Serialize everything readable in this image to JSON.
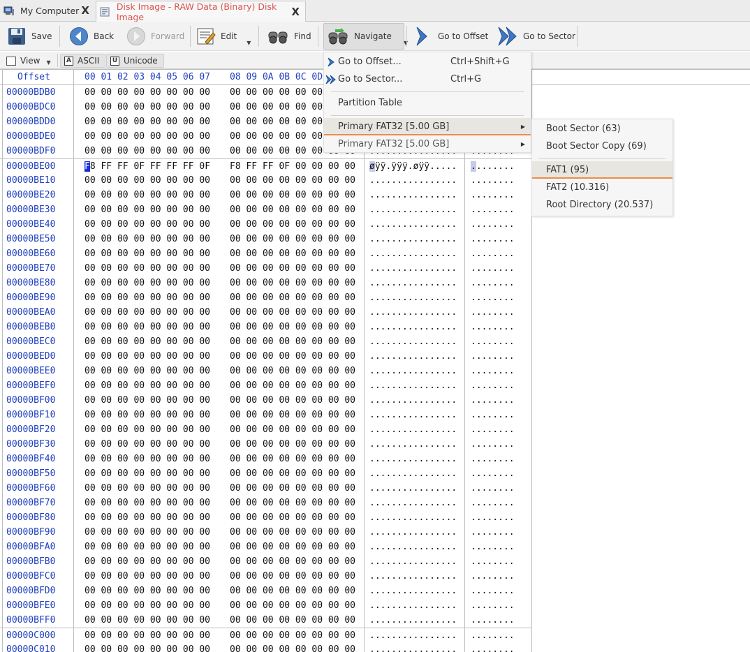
{
  "tabs": [
    {
      "label": "My Computer",
      "close": "X"
    },
    {
      "label": "Disk Image - RAW Data (Binary) Disk Image",
      "close": "X"
    }
  ],
  "toolbar": {
    "save": "Save",
    "back": "Back",
    "forward": "Forward",
    "edit": "Edit",
    "find": "Find",
    "navigate": "Navigate",
    "goto_offset": "Go to Offset",
    "goto_sector": "Go to Sector"
  },
  "viewbar": {
    "view": "View",
    "ascii": "ASCII",
    "ascii_icon": "A",
    "unicode": "Unicode",
    "unicode_icon": "U"
  },
  "hex": {
    "offset_header": "Offset",
    "cols_1": "00 01 02 03 04 05 06 07",
    "cols_2": "08 09 0A 0B 0C 0D",
    "zero_group": "00 00 00 00 00 00 00 00",
    "zero_ascii": "................",
    "zero_unicode": "........",
    "rows_before": [
      "00000BDB0",
      "00000BDC0",
      "00000BDD0",
      "00000BDE0",
      "00000BDF0"
    ],
    "special_row": {
      "offset": "00000BE00",
      "cursor_char": "F",
      "h1_rest": "8 FF FF 0F FF FF FF 0F",
      "h2": "F8 FF FF 0F 00 00 00 00",
      "ascii_first": "ø",
      "ascii_rest": "ÿÿ.ÿÿÿ.øÿÿ.....",
      "unicode_first": ".",
      "unicode_rest": "......."
    },
    "rows_after": [
      "00000BE10",
      "00000BE20",
      "00000BE30",
      "00000BE40",
      "00000BE50",
      "00000BE60",
      "00000BE70",
      "00000BE80",
      "00000BE90",
      "00000BEA0",
      "00000BEB0",
      "00000BEC0",
      "00000BED0",
      "00000BEE0",
      "00000BEF0",
      "00000BF00",
      "00000BF10",
      "00000BF20",
      "00000BF30",
      "00000BF40",
      "00000BF50",
      "00000BF60",
      "00000BF70",
      "00000BF80",
      "00000BF90",
      "00000BFA0",
      "00000BFB0",
      "00000BFC0",
      "00000BFD0",
      "00000BFE0",
      "00000BFF0"
    ],
    "rows_next_sector": [
      "00000C000",
      "00000C010"
    ]
  },
  "navigate_menu": {
    "goto_offset": "Go to Offset...",
    "goto_offset_shortcut": "Ctrl+Shift+G",
    "goto_sector": "Go to Sector...",
    "goto_sector_shortcut": "Ctrl+G",
    "partition_table": "Partition Table",
    "primary_1": "Primary FAT32 [5.00 GB]",
    "primary_2": "Primary FAT32 [5.00 GB]"
  },
  "submenu": {
    "boot_sector": "Boot Sector (63)",
    "boot_sector_copy": "Boot Sector Copy (69)",
    "fat1": "FAT1 (95)",
    "fat2": "FAT2 (10.316)",
    "root_dir": "Root Directory (20.537)"
  },
  "colors": {
    "accent_orange": "#f08a4b",
    "offset_blue": "#1f3fbf",
    "tab_active_text": "#d9534f"
  }
}
